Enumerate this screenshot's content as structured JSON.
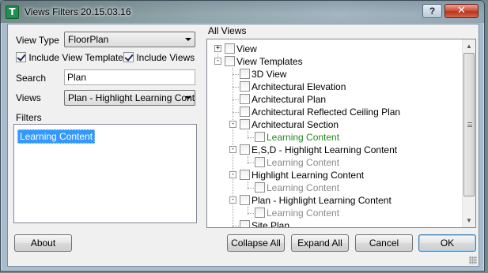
{
  "window": {
    "title": "Views Filters 20.15.03.16",
    "app_icon_letter": "T",
    "help_label": "?",
    "close_label": "✕"
  },
  "left": {
    "view_type_label": "View Type",
    "view_type_value": "FloorPlan",
    "include_view_templates_label": "Include View Templates",
    "include_view_templates_checked": true,
    "include_views_label": "Include Views",
    "include_views_checked": true,
    "search_label": "Search",
    "search_value": "Plan",
    "views_label": "Views",
    "views_value": "Plan - Highlight Learning Conte",
    "filters_label": "Filters",
    "filters": [
      "Learning Content"
    ]
  },
  "tree": {
    "header": "All Views",
    "rows": [
      {
        "label": "View",
        "level": 0,
        "expander": "+",
        "color": "normal"
      },
      {
        "label": "View Templates",
        "level": 0,
        "expander": "−",
        "color": "normal"
      },
      {
        "label": "3D View",
        "level": 1,
        "expander": "",
        "color": "normal"
      },
      {
        "label": "Architectural Elevation",
        "level": 1,
        "expander": "",
        "color": "normal"
      },
      {
        "label": "Architectural Plan",
        "level": 1,
        "expander": "",
        "color": "normal"
      },
      {
        "label": "Architectural Reflected Ceiling Plan",
        "level": 1,
        "expander": "",
        "color": "normal"
      },
      {
        "label": "Architectural Section",
        "level": 1,
        "expander": "−",
        "color": "normal"
      },
      {
        "label": "Learning Content",
        "level": 2,
        "expander": "",
        "color": "green"
      },
      {
        "label": "E,S,D - Highlight Learning Content",
        "level": 1,
        "expander": "−",
        "color": "normal"
      },
      {
        "label": "Learning Content",
        "level": 2,
        "expander": "",
        "color": "gray"
      },
      {
        "label": "Highlight Learning Content",
        "level": 1,
        "expander": "−",
        "color": "normal"
      },
      {
        "label": "Learning Content",
        "level": 2,
        "expander": "",
        "color": "gray"
      },
      {
        "label": "Plan - Highlight Learning Content",
        "level": 1,
        "expander": "−",
        "color": "normal"
      },
      {
        "label": "Learning Content",
        "level": 2,
        "expander": "",
        "color": "gray"
      },
      {
        "label": "Site Plan",
        "level": 1,
        "expander": "",
        "color": "normal"
      }
    ]
  },
  "buttons": {
    "about": "About",
    "collapse_all": "Collapse All",
    "expand_all": "Expand All",
    "cancel": "Cancel",
    "ok": "OK"
  },
  "colors": {
    "selection": "#3399ff",
    "green_item": "#1f8a1f",
    "gray_item": "#8a8a8a",
    "close_button": "#c9412a"
  },
  "icons": [
    "app-icon",
    "help-icon",
    "close-icon",
    "dropdown-arrow-icon",
    "expander-icon",
    "scroll-up-icon",
    "scroll-down-icon"
  ]
}
